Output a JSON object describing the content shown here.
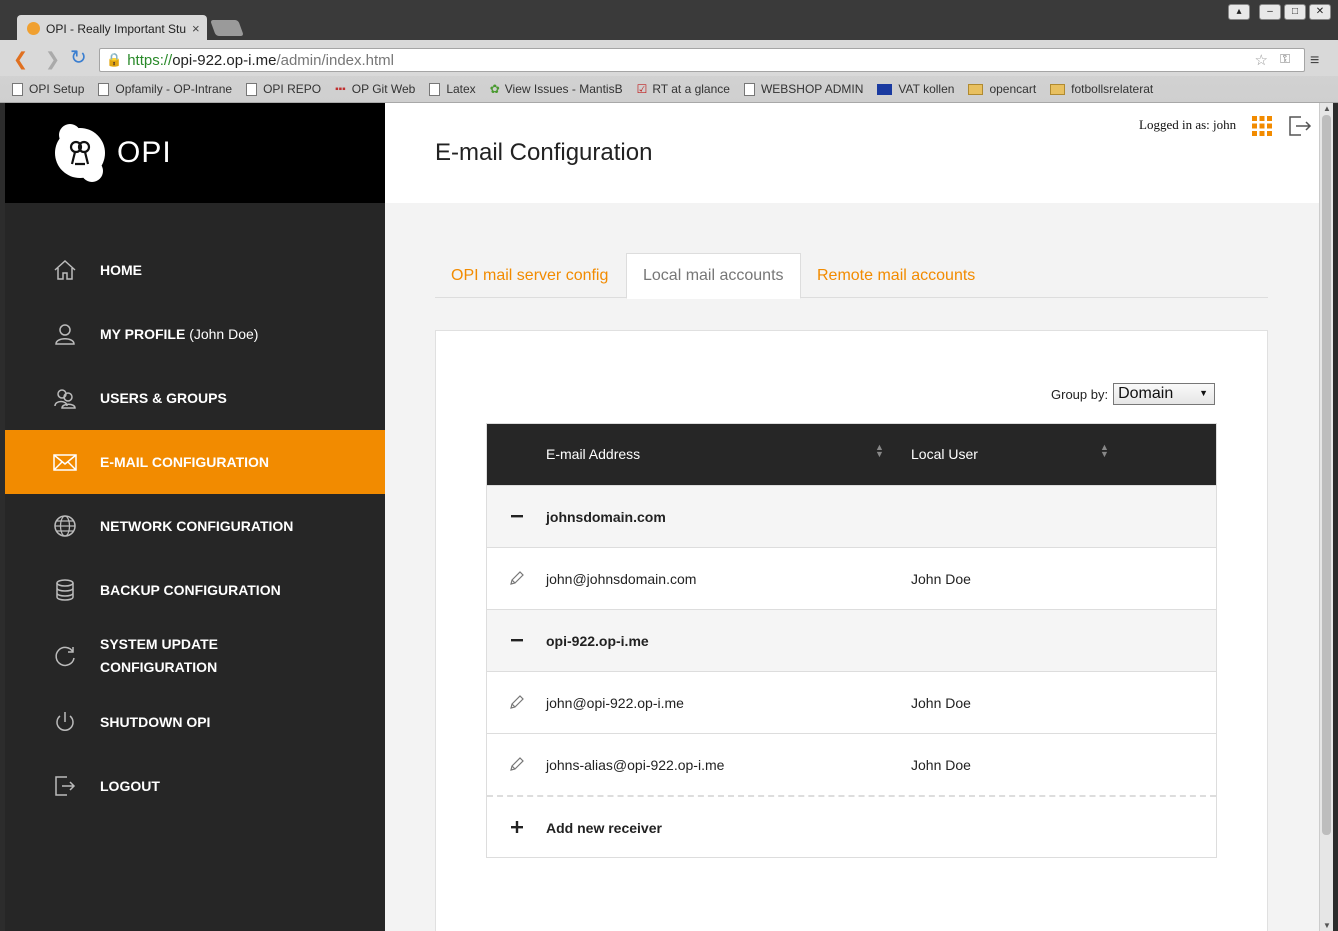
{
  "browser": {
    "tab_title": "OPI - Really Important Stu",
    "tab_close": "×",
    "url_scheme": "https://",
    "url_host": "opi-922.op-i.me",
    "url_path": "/admin/index.html",
    "bookmarks": [
      {
        "label": "OPI Setup",
        "icon": "page-icon"
      },
      {
        "label": "Opfamily - OP-Intrane",
        "icon": "page-icon"
      },
      {
        "label": "OPI REPO",
        "icon": "page-icon"
      },
      {
        "label": "OP Git Web",
        "icon": "git-icon"
      },
      {
        "label": "Latex",
        "icon": "page-icon"
      },
      {
        "label": "View Issues - MantisB",
        "icon": "mantis-icon"
      },
      {
        "label": "RT at a glance",
        "icon": "check-icon"
      },
      {
        "label": "WEBSHOP ADMIN",
        "icon": "page-icon"
      },
      {
        "label": "VAT kollen",
        "icon": "eu-flag-icon"
      },
      {
        "label": "opencart",
        "icon": "folder-icon"
      },
      {
        "label": "fotbollsrelaterat",
        "icon": "folder-icon"
      }
    ]
  },
  "brand": {
    "name": "OPI",
    "accent": "#f28b00"
  },
  "sidebar": {
    "items": [
      {
        "label": "HOME",
        "sub": "",
        "icon": "home-icon"
      },
      {
        "label": "MY PROFILE",
        "sub": " (John Doe)",
        "icon": "user-icon"
      },
      {
        "label": "USERS & GROUPS",
        "sub": "",
        "icon": "users-icon"
      },
      {
        "label": "E-MAIL CONFIGURATION",
        "sub": "",
        "icon": "envelope-icon",
        "active": true
      },
      {
        "label": "NETWORK CONFIGURATION",
        "sub": "",
        "icon": "globe-icon"
      },
      {
        "label": "BACKUP CONFIGURATION",
        "sub": "",
        "icon": "database-icon"
      },
      {
        "label": "SYSTEM UPDATE",
        "label2": "CONFIGURATION",
        "sub": "",
        "icon": "refresh-icon"
      },
      {
        "label": "SHUTDOWN OPI",
        "sub": "",
        "icon": "power-icon"
      },
      {
        "label": "LOGOUT",
        "sub": "",
        "icon": "logout-icon"
      }
    ]
  },
  "header": {
    "title": "E-mail Configuration",
    "logged_in": "Logged in as: john"
  },
  "tabs": [
    {
      "label": "OPI mail server config",
      "active": false
    },
    {
      "label": "Local mail accounts",
      "active": true
    },
    {
      "label": "Remote mail accounts",
      "active": false
    }
  ],
  "group_by": {
    "label": "Group by:",
    "value": "Domain"
  },
  "table": {
    "columns": [
      "E-mail Address",
      "Local User"
    ],
    "groups": [
      {
        "domain": "johnsdomain.com",
        "rows": [
          {
            "email": "john@johnsdomain.com",
            "user": "John Doe"
          }
        ]
      },
      {
        "domain": "opi-922.op-i.me",
        "rows": [
          {
            "email": "john@opi-922.op-i.me",
            "user": "John Doe"
          },
          {
            "email": "johns-alias@opi-922.op-i.me",
            "user": "John Doe"
          }
        ]
      }
    ],
    "add_label": "Add new receiver"
  }
}
